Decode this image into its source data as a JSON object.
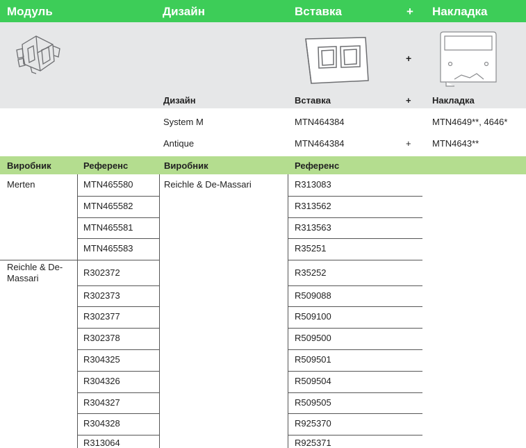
{
  "header": {
    "module": "Модуль",
    "design": "Дизайн",
    "insert": "Вставка",
    "plus": "+",
    "cover": "Накладка"
  },
  "images": {
    "module": "keystone-module-image",
    "insert": "insert-frame-image",
    "cover": "cover-plate-image"
  },
  "subheader": {
    "design": "Дизайн",
    "insert": "Вставка",
    "plus": "+",
    "cover": "Накладка"
  },
  "design_rows": [
    {
      "design": "System M",
      "insert": "MTN464384",
      "plus": "",
      "cover": "MTN4649**, 4646*"
    },
    {
      "design": "Antique",
      "insert": "MTN464384",
      "plus": "+",
      "cover": "MTN4643**"
    }
  ],
  "table_headers": {
    "manufacturer_left": "Виробник",
    "reference_left": "Референс",
    "manufacturer_right": "Виробник",
    "reference_right": "Референс"
  },
  "left_groups": [
    {
      "manufacturer": "Merten",
      "refs": [
        "MTN465580",
        "MTN465582",
        "MTN465581",
        "MTN465583"
      ]
    },
    {
      "manufacturer": "Reichle & De-Massari",
      "refs": [
        "R302372",
        "R302373",
        "R302377",
        "R302378",
        "R304325",
        "R304326",
        "R304327",
        "R304328",
        "R313064"
      ]
    }
  ],
  "right_groups": [
    {
      "manufacturer": "Reichle & De-Massari",
      "refs": [
        "R313083",
        "R313562",
        "R313563",
        "R35251",
        "R35252",
        "R509088",
        "R509100",
        "R509500",
        "R509501",
        "R509504",
        "R509505",
        "R925370",
        "R925371"
      ]
    }
  ]
}
